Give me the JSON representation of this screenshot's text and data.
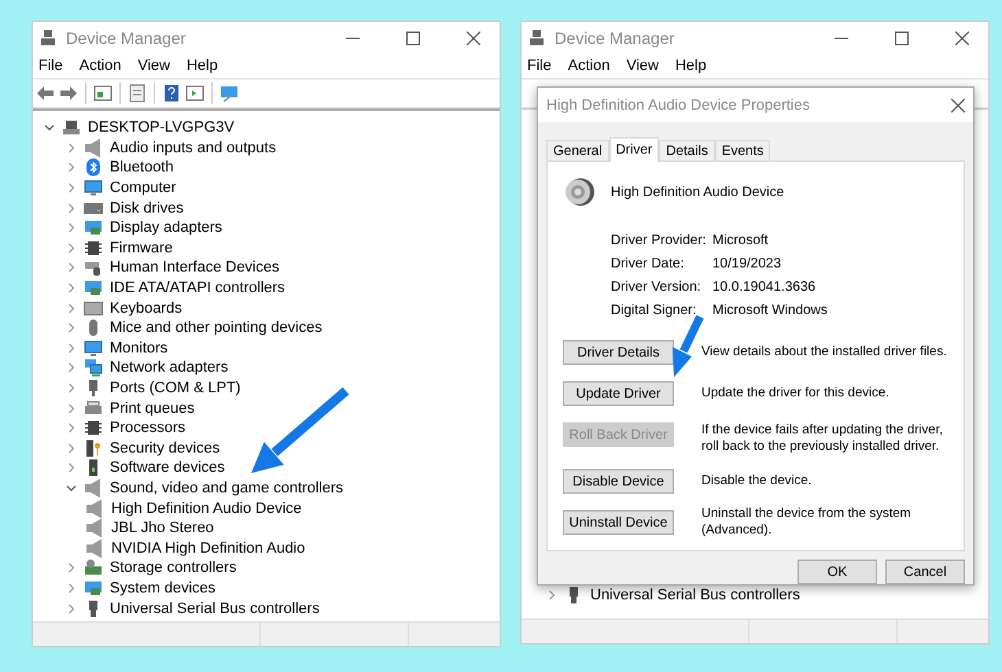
{
  "left_window": {
    "title": "Device Manager",
    "menu": [
      "File",
      "Action",
      "View",
      "Help"
    ],
    "tree": {
      "label": "DESKTOP-LVGPG3V",
      "kind": "computer",
      "expanded": true,
      "children": [
        {
          "label": "Audio inputs and outputs",
          "kind": "speaker",
          "expanded": false
        },
        {
          "label": "Bluetooth",
          "kind": "bluetooth",
          "expanded": false
        },
        {
          "label": "Computer",
          "kind": "monitor",
          "expanded": false
        },
        {
          "label": "Disk drives",
          "kind": "disk",
          "expanded": false
        },
        {
          "label": "Display adapters",
          "kind": "display",
          "expanded": false
        },
        {
          "label": "Firmware",
          "kind": "chip",
          "expanded": false
        },
        {
          "label": "Human Interface Devices",
          "kind": "hid",
          "expanded": false
        },
        {
          "label": "IDE ATA/ATAPI controllers",
          "kind": "display",
          "expanded": false
        },
        {
          "label": "Keyboards",
          "kind": "keyboard",
          "expanded": false
        },
        {
          "label": "Mice and other pointing devices",
          "kind": "mouse",
          "expanded": false
        },
        {
          "label": "Monitors",
          "kind": "monitor",
          "expanded": false
        },
        {
          "label": "Network adapters",
          "kind": "network",
          "expanded": false
        },
        {
          "label": "Ports (COM & LPT)",
          "kind": "port",
          "expanded": false
        },
        {
          "label": "Print queues",
          "kind": "printer",
          "expanded": false
        },
        {
          "label": "Processors",
          "kind": "chip",
          "expanded": false
        },
        {
          "label": "Security devices",
          "kind": "security",
          "expanded": false
        },
        {
          "label": "Software devices",
          "kind": "software",
          "expanded": false
        },
        {
          "label": "Sound, video and game controllers",
          "kind": "speaker",
          "expanded": true,
          "children": [
            {
              "label": "High Definition Audio Device",
              "kind": "speaker"
            },
            {
              "label": "JBL Jho Stereo",
              "kind": "speaker"
            },
            {
              "label": "NVIDIA High Definition Audio",
              "kind": "speaker"
            }
          ]
        },
        {
          "label": "Storage controllers",
          "kind": "storage",
          "expanded": false
        },
        {
          "label": "System devices",
          "kind": "display",
          "expanded": false
        },
        {
          "label": "Universal Serial Bus controllers",
          "kind": "usb",
          "expanded": false
        }
      ]
    }
  },
  "right_window": {
    "title": "Device Manager",
    "menu": [
      "File",
      "Action",
      "View",
      "Help"
    ],
    "tree_visible": [
      {
        "label": "Universal Serial Bus controllers",
        "kind": "usb",
        "expanded": false
      }
    ],
    "dialog": {
      "title": "High Definition Audio Device Properties",
      "tabs": [
        {
          "label": "General",
          "selected": false
        },
        {
          "label": "Driver",
          "selected": true
        },
        {
          "label": "Details",
          "selected": false
        },
        {
          "label": "Events",
          "selected": false
        }
      ],
      "device_name": "High Definition Audio Device",
      "fields": [
        {
          "label": "Driver Provider:",
          "value": "Microsoft"
        },
        {
          "label": "Driver Date:",
          "value": "10/19/2023"
        },
        {
          "label": "Driver Version:",
          "value": "10.0.19041.3636"
        },
        {
          "label": "Digital Signer:",
          "value": "Microsoft Windows"
        }
      ],
      "actions": [
        {
          "button": "Driver Details",
          "description": "View details about the installed driver files.",
          "disabled": false
        },
        {
          "button": "Update Driver",
          "description": "Update the driver for this device.",
          "disabled": false
        },
        {
          "button": "Roll Back Driver",
          "description": "If the device fails after updating the driver, roll back to the previously installed driver.",
          "disabled": true
        },
        {
          "button": "Disable Device",
          "description": "Disable the device.",
          "disabled": false
        },
        {
          "button": "Uninstall Device",
          "description": "Uninstall the device from the system (Advanced).",
          "disabled": false
        }
      ],
      "buttons": [
        "OK",
        "Cancel"
      ]
    }
  }
}
